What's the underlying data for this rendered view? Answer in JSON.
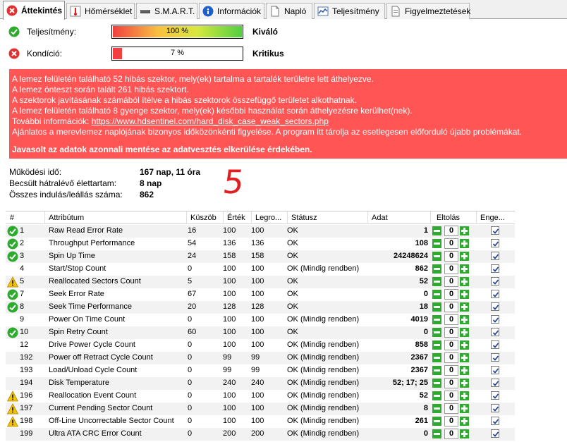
{
  "tabs": [
    {
      "label": "Áttekintés",
      "icon": "red-x-icon",
      "active": true
    },
    {
      "label": "Hőmérséklet",
      "icon": "thermometer-icon"
    },
    {
      "label": "S.M.A.R.T.",
      "icon": "drive-icon"
    },
    {
      "label": "Információk",
      "icon": "info-icon"
    },
    {
      "label": "Napló",
      "icon": "document-icon"
    },
    {
      "label": "Teljesítmény",
      "icon": "chart-icon"
    },
    {
      "label": "Figyelmeztetések",
      "icon": "warning-document-icon"
    }
  ],
  "status": {
    "performance": {
      "label": "Teljesítmény:",
      "value": "100 %",
      "percent": 100,
      "verdict": "Kiváló",
      "icon": "green-check-icon"
    },
    "health": {
      "label": "Kondíció:",
      "value": "7 %",
      "percent": 7,
      "verdict": "Kritikus",
      "icon": "red-x-icon"
    }
  },
  "alert": {
    "lines": [
      "A lemez felületén található 52 hibás szektor, mely(ek) tartalma a tartalék területre lett áthelyezve.",
      "A lemez önteszt során talált 261 hibás szektort.",
      "A szektorok javításának számából ítélve a hibás szektorok összefüggő területet alkothatnak.",
      "A lemez felületén található 8 gyenge szektor, mely(ek) későbbi használat során áthelyezésre kerülhet(nek)."
    ],
    "more_info_prefix": "További információk: ",
    "more_info_link": "https://www.hdsentinel.com/hard_disk_case_weak_sectors.php",
    "recommendation": "Ajánlatos a merevlemez naplójának bizonyos időközönkénti figyelése. A program itt tárolja az esetlegesen előforduló újabb problémákat.",
    "bold_line": "Javasolt az adatok azonnali mentése az adatvesztés elkerülése érdekében."
  },
  "info": {
    "uptime": {
      "label": "Működési idő:",
      "value": "167 nap, 11 óra"
    },
    "lifetime": {
      "label": "Becsült hátralévő élettartam:",
      "value": "8 nap"
    },
    "startstop": {
      "label": "Összes indulás/leállás száma:",
      "value": "862"
    }
  },
  "handwriting": "5",
  "table": {
    "headers": [
      "#",
      "Attribútum",
      "Küszöb",
      "Érték",
      "Legro...",
      "Státusz",
      "Adat",
      "Eltolás",
      "Enge..."
    ],
    "rows": [
      {
        "num": "1",
        "name": "Raw Read Error Rate",
        "threshold": "16",
        "value": "100",
        "worst": "100",
        "status": "OK",
        "data": "1",
        "offset": "0",
        "icon": "ok"
      },
      {
        "num": "2",
        "name": "Throughput Performance",
        "threshold": "54",
        "value": "136",
        "worst": "136",
        "status": "OK",
        "data": "108",
        "offset": "0",
        "icon": "ok"
      },
      {
        "num": "3",
        "name": "Spin Up Time",
        "threshold": "24",
        "value": "158",
        "worst": "158",
        "status": "OK",
        "data": "24248624",
        "offset": "0",
        "icon": "ok"
      },
      {
        "num": "4",
        "name": "Start/Stop Count",
        "threshold": "0",
        "value": "100",
        "worst": "100",
        "status": "OK (Mindig rendben)",
        "data": "862",
        "offset": "0",
        "icon": ""
      },
      {
        "num": "5",
        "name": "Reallocated Sectors Count",
        "threshold": "5",
        "value": "100",
        "worst": "100",
        "status": "OK",
        "data": "52",
        "offset": "0",
        "icon": "warn"
      },
      {
        "num": "7",
        "name": "Seek Error Rate",
        "threshold": "67",
        "value": "100",
        "worst": "100",
        "status": "OK",
        "data": "0",
        "offset": "0",
        "icon": "ok"
      },
      {
        "num": "8",
        "name": "Seek Time Performance",
        "threshold": "20",
        "value": "128",
        "worst": "128",
        "status": "OK",
        "data": "18",
        "offset": "0",
        "icon": "ok"
      },
      {
        "num": "9",
        "name": "Power On Time Count",
        "threshold": "0",
        "value": "100",
        "worst": "100",
        "status": "OK (Mindig rendben)",
        "data": "4019",
        "offset": "0",
        "icon": ""
      },
      {
        "num": "10",
        "name": "Spin Retry Count",
        "threshold": "60",
        "value": "100",
        "worst": "100",
        "status": "OK",
        "data": "0",
        "offset": "0",
        "icon": "ok"
      },
      {
        "num": "12",
        "name": "Drive Power Cycle Count",
        "threshold": "0",
        "value": "100",
        "worst": "100",
        "status": "OK (Mindig rendben)",
        "data": "858",
        "offset": "0",
        "icon": ""
      },
      {
        "num": "192",
        "name": "Power off Retract Cycle Count",
        "threshold": "0",
        "value": "99",
        "worst": "99",
        "status": "OK (Mindig rendben)",
        "data": "2367",
        "offset": "0",
        "icon": ""
      },
      {
        "num": "193",
        "name": "Load/Unload Cycle Count",
        "threshold": "0",
        "value": "99",
        "worst": "99",
        "status": "OK (Mindig rendben)",
        "data": "2367",
        "offset": "0",
        "icon": ""
      },
      {
        "num": "194",
        "name": "Disk Temperature",
        "threshold": "0",
        "value": "240",
        "worst": "240",
        "status": "OK (Mindig rendben)",
        "data": "52; 17; 25",
        "offset": "0",
        "icon": ""
      },
      {
        "num": "196",
        "name": "Reallocation Event Count",
        "threshold": "0",
        "value": "100",
        "worst": "100",
        "status": "OK (Mindig rendben)",
        "data": "52",
        "offset": "0",
        "icon": "warn"
      },
      {
        "num": "197",
        "name": "Current Pending Sector Count",
        "threshold": "0",
        "value": "100",
        "worst": "100",
        "status": "OK (Mindig rendben)",
        "data": "8",
        "offset": "0",
        "icon": "warn"
      },
      {
        "num": "198",
        "name": "Off-Line Uncorrectable Sector Count",
        "threshold": "0",
        "value": "100",
        "worst": "100",
        "status": "OK (Mindig rendben)",
        "data": "261",
        "offset": "0",
        "icon": "warn"
      },
      {
        "num": "199",
        "name": "Ultra ATA CRC Error Count",
        "threshold": "0",
        "value": "200",
        "worst": "200",
        "status": "OK (Mindig rendben)",
        "data": "0",
        "offset": "0",
        "icon": ""
      }
    ]
  },
  "colors": {
    "alert_bg": "#ff5555",
    "ok_green": "#2eaa2e",
    "warn_yellow": "#f5c400",
    "error_red": "#e03030",
    "handwriting_red": "#e02020"
  }
}
